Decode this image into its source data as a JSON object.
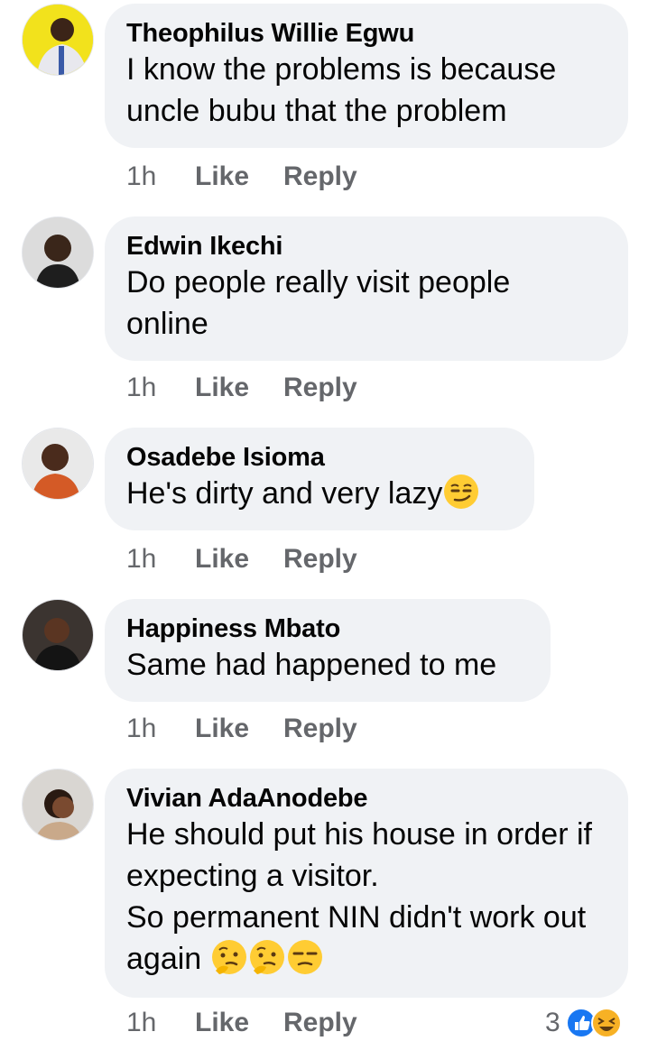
{
  "comments": [
    {
      "author": "Theophilus Willie Egwu",
      "text": "I know the problems is because uncle bubu that the problem",
      "time": "1h",
      "like": "Like",
      "reply": "Reply"
    },
    {
      "author": "Edwin Ikechi",
      "text": "Do people really visit people online",
      "time": "1h",
      "like": "Like",
      "reply": "Reply"
    },
    {
      "author": "Osadebe Isioma",
      "text": "He's dirty and very lazy",
      "emoji": "smirking-face",
      "time": "1h",
      "like": "Like",
      "reply": "Reply"
    },
    {
      "author": "Happiness Mbato",
      "text": "Same had happened to me",
      "time": "1h",
      "like": "Like",
      "reply": "Reply"
    },
    {
      "author": "Vivian AdaAnodebe",
      "text": "He should put his house in order if expecting a visitor.\nSo permanent NIN didn't work out again ",
      "emoji": [
        "thinking-face",
        "thinking-face",
        "unamused-face"
      ],
      "time": "1h",
      "like": "Like",
      "reply": "Reply",
      "reaction_count": "3",
      "reaction_icons": [
        "like-icon",
        "haha-icon"
      ]
    }
  ],
  "colors": {
    "bubble": "#f0f2f5",
    "meta": "#65676b",
    "text": "#050505",
    "like_blue": "#1877f2"
  }
}
